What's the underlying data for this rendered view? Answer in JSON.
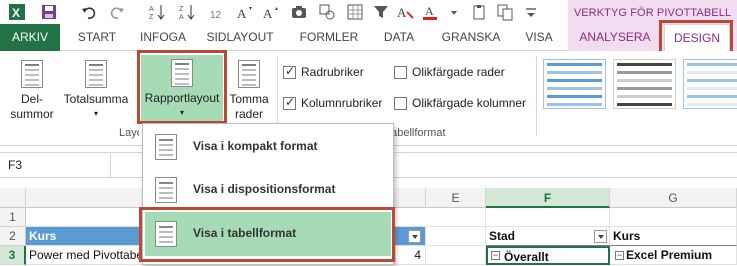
{
  "context_tab_group": {
    "title": "VERKTYG FÖR PIVOTTABELL"
  },
  "tabs": [
    "ARKIV",
    "START",
    "INFOGA",
    "SIDLAYOUT",
    "FORMLER",
    "DATA",
    "GRANSKA",
    "VISA",
    "ANALYSERA",
    "DESIGN"
  ],
  "ribbon": {
    "layout_group": {
      "label": "Layout",
      "delsummor_line1": "Del-",
      "delsummor_line2": "summor",
      "totalsumma": "Totalsumma",
      "rapportlayout": "Rapportlayout",
      "tomma_line1": "Tomma",
      "tomma_line2": "rader"
    },
    "style_options": {
      "label": "Alternativ för pivottabellformat",
      "radrubriker": "Radrubriker",
      "kolumnrubriker": "Kolumnrubriker",
      "olikfargade_rader": "Olikfärgade rader",
      "olikfargade_kolumner": "Olikfärgade kolumner",
      "radrubriker_checked": true,
      "kolumnrubriker_checked": true,
      "olikfargade_rader_checked": false,
      "olikfargade_kolumner_checked": false
    }
  },
  "formula_bar": {
    "name_box": "F3"
  },
  "columns": [
    "A",
    "E",
    "F",
    "G"
  ],
  "rows": [
    "1",
    "2",
    "3"
  ],
  "cells": {
    "a2": "Kurs",
    "a3": "Power med Pivottabeller",
    "d3": "4",
    "f2": "Stad",
    "g2": "Kurs",
    "f3": "Överallt",
    "g3": "Excel Premium"
  },
  "menu": {
    "items": [
      "Visa i kompakt format",
      "Visa i dispositionsformat",
      "Visa i tabellformat"
    ]
  },
  "colors": {
    "excel_green": "#217346",
    "context_purple": "#8f2a84",
    "highlight_frame": "#b84a36",
    "header_blue": "#5b9bd5"
  }
}
